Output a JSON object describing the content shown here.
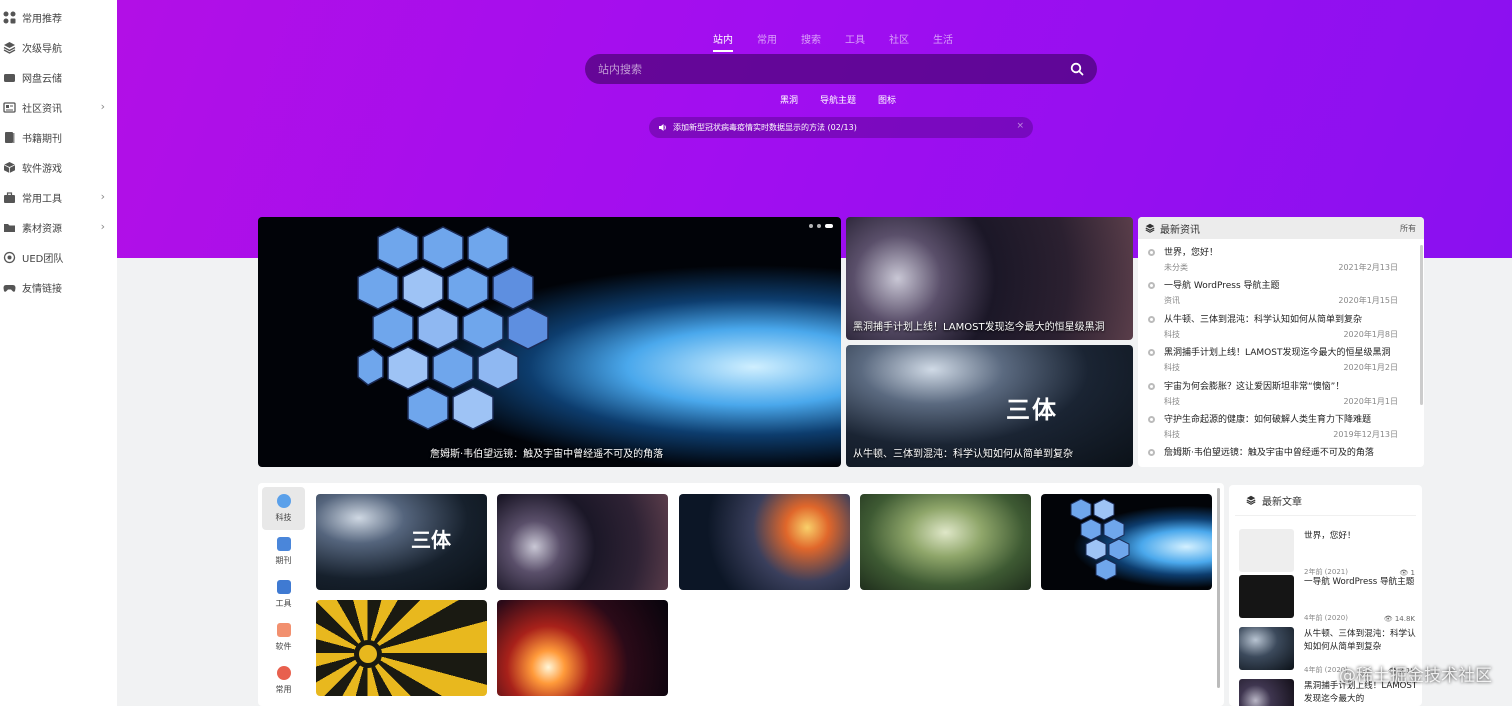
{
  "sidebar": {
    "items": [
      {
        "label": "常用推荐",
        "icon": "apps-icon",
        "has_arrow": false
      },
      {
        "label": "次级导航",
        "icon": "layers-icon",
        "has_arrow": false
      },
      {
        "label": "网盘云储",
        "icon": "cloud-drive-icon",
        "has_arrow": false
      },
      {
        "label": "社区资讯",
        "icon": "news-icon",
        "has_arrow": true
      },
      {
        "label": "书籍期刊",
        "icon": "book-icon",
        "has_arrow": false
      },
      {
        "label": "软件游戏",
        "icon": "cube-icon",
        "has_arrow": false
      },
      {
        "label": "常用工具",
        "icon": "toolbox-icon",
        "has_arrow": true
      },
      {
        "label": "素材资源",
        "icon": "folder-icon",
        "has_arrow": true
      },
      {
        "label": "UED团队",
        "icon": "team-icon",
        "has_arrow": false
      },
      {
        "label": "友情链接",
        "icon": "gamepad-icon",
        "has_arrow": false
      }
    ],
    "arrow": "›"
  },
  "hero": {
    "tabs": [
      "站内",
      "常用",
      "搜索",
      "工具",
      "社区",
      "生活"
    ],
    "active_tab": 0,
    "search_placeholder": "站内搜索",
    "hotwords": [
      "黑洞",
      "导航主题",
      "图标"
    ],
    "notice": "添加新型冠状病毒疫情实时数据显示的方法 (02/13)",
    "notice_close": "×"
  },
  "featured": {
    "big_caption": "詹姆斯·韦伯望远镜：触及宇宙中曾经遥不可及的角落",
    "small1_caption": "黑洞捕手计划上线！LAMOST发现迄今最大的恒星级黑洞",
    "small2_caption": "从牛顿、三体到混沌：科学认知如何从简单到复杂"
  },
  "news": {
    "title": "最新资讯",
    "all_label": "所有",
    "items": [
      {
        "title": "世界，您好！",
        "category": "未分类",
        "date": "2021年2月13日"
      },
      {
        "title": "一导航 WordPress 导航主题",
        "category": "资讯",
        "date": "2020年1月15日"
      },
      {
        "title": "从牛顿、三体到混沌：科学认知如何从简单到复杂",
        "category": "科技",
        "date": "2020年1月8日"
      },
      {
        "title": "黑洞捕手计划上线！LAMOST发现迄今最大的恒星级黑洞",
        "category": "科技",
        "date": "2020年1月2日"
      },
      {
        "title": "宇宙为何会膨胀？这让爱因斯坦非常“懊恼”！",
        "category": "科技",
        "date": "2020年1月1日"
      },
      {
        "title": "守护生命起源的健康：如何破解人类生育力下降难题",
        "category": "科技",
        "date": "2019年12月13日"
      },
      {
        "title": "詹姆斯·韦伯望远镜：触及宇宙中曾经遥不可及的角落",
        "category": "",
        "date": ""
      }
    ]
  },
  "categories": {
    "tabs": [
      {
        "label": "科技",
        "color": "#4a90e2"
      },
      {
        "label": "期刊",
        "color": "#3a7bd5"
      },
      {
        "label": "工具",
        "color": "#2f6fd0"
      },
      {
        "label": "软件",
        "color": "#f07b5a"
      },
      {
        "label": "常用",
        "color": "#e8554e"
      }
    ],
    "active_tab": 0
  },
  "articles": {
    "title": "最新文章",
    "items": [
      {
        "title": "世界，您好！",
        "time": "2年前 (2021)",
        "views": "1"
      },
      {
        "title": "一导航 WordPress 导航主题",
        "time": "4年前 (2020)",
        "views": "14.8K"
      },
      {
        "title": "从牛顿、三体到混沌：科学认知如何从简单到复杂",
        "time": "4年前 (2020)",
        "views": "3.1K"
      },
      {
        "title": "黑洞捕手计划上线！LAMOST发现迄今最大的",
        "time": "",
        "views": ""
      }
    ]
  },
  "watermark": "@稀土掘金技术社区",
  "colors": {
    "hero_start": "#b20fe6",
    "hero_end": "#8a10f0",
    "accent": "#a10ef0"
  }
}
